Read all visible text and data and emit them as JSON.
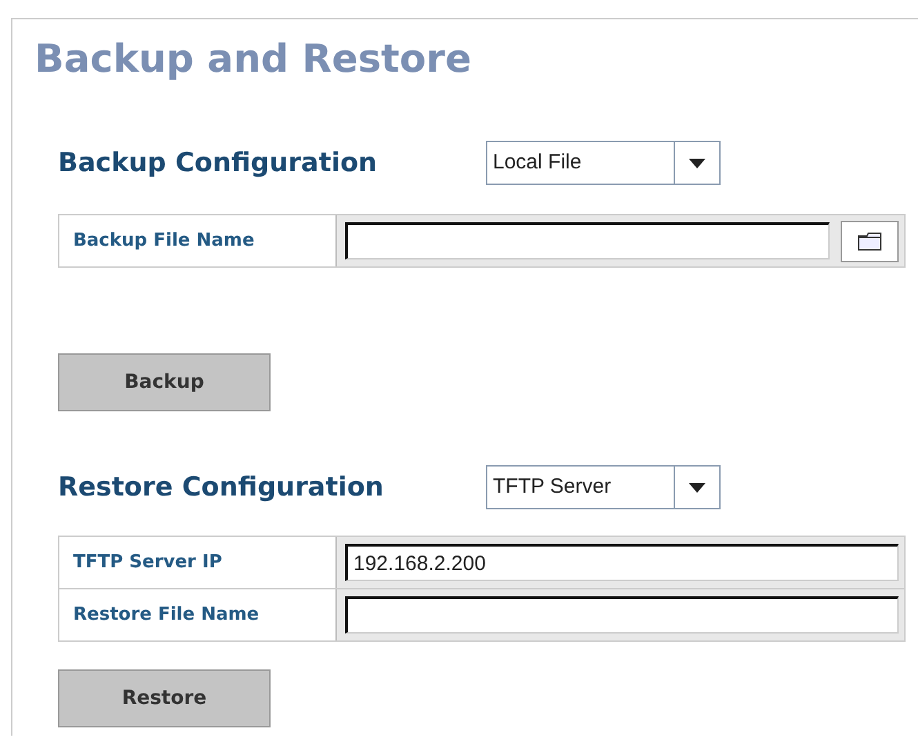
{
  "title": "Backup and Restore",
  "sections": [
    {
      "heading": "Backup Configuration",
      "dropdown": "Local File",
      "fields": [
        {
          "label": "Backup File Name",
          "browse": true
        }
      ],
      "button": "Backup"
    },
    {
      "heading": "Restore Configuration",
      "dropdown": "TFTP Server",
      "fields": [
        {
          "label": "TFTP Server IP",
          "value": "192.168.2.200",
          "browse": false
        },
        {
          "label": "Restore File Name",
          "browse": false
        }
      ],
      "button": "Restore"
    }
  ]
}
